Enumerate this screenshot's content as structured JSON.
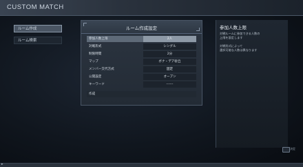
{
  "header": {
    "title": "CUSTOM MATCH"
  },
  "sidebar": {
    "items": [
      {
        "label": "ルーム作成"
      },
      {
        "label": "ルーム検索"
      }
    ]
  },
  "panel": {
    "title": "ルーム作成設定",
    "rows": [
      {
        "label": "参加人数上限",
        "value": "2人"
      },
      {
        "label": "対戦形式",
        "value": "シングル"
      },
      {
        "label": "制限時間",
        "value": "2分"
      },
      {
        "label": "マップ",
        "value": "ボナ・デア砂丘"
      },
      {
        "label": "メンバー交代方式",
        "value": "固定"
      },
      {
        "label": "公開設定",
        "value": "オープン"
      },
      {
        "label": "キーワード",
        "value": "------"
      },
      {
        "label": "作成",
        "value": ""
      }
    ]
  },
  "info": {
    "title": "参加人数上限",
    "lines": [
      "対戦ルームに参加できる人数の",
      "上限を設定します",
      "",
      "対戦形式によって",
      "選択可能な人数は異なります"
    ]
  },
  "footer": {
    "hint": "決定"
  }
}
